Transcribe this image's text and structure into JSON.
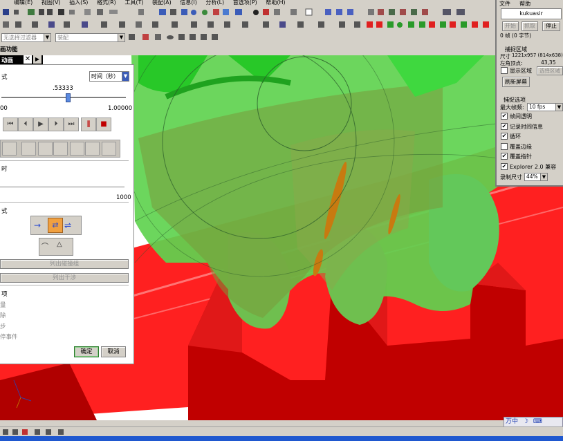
{
  "menubar": {
    "items": [
      "编辑(E)",
      "视图(V)",
      "插入(S)",
      "格式(R)",
      "工具(T)",
      "装配(A)",
      "信息(I)",
      "分析(L)",
      "首选项(P)",
      "帮助(H)"
    ]
  },
  "toolbar": {
    "combo1_text": "无选择过滤器",
    "combo2_text": "装配"
  },
  "tab_strip": {
    "title": "画功能",
    "tab_label": "动画"
  },
  "anim_panel": {
    "mode_label_1": "式",
    "time_select": "时间（秒）",
    "slider_value": ".53333",
    "slider_min": "00",
    "slider_max": "1.00000",
    "slider_fraction": 0.53,
    "section_time": "时",
    "steps_max": "1000",
    "mode_label_2": "式",
    "list_btn_1": "列出碰撞组",
    "list_btn_2": "列出干涉",
    "opt_header": "项",
    "opt_1": "量",
    "opt_2": "除",
    "opt_3": "步",
    "opt_4": "停事件",
    "ok": "确定",
    "cancel": "取消"
  },
  "recorder": {
    "menu_file": "文件",
    "menu_help": "帮助",
    "title_field": "kukuasir",
    "btn_start": "开始",
    "btn_capture": "抓取",
    "btn_stop": "停止",
    "frames_text": "0 帧 (0 字节)",
    "capture_area_header": "捕捉区域",
    "size_label": "尺寸",
    "size_value": "1221x957 (814x638)",
    "corner_label": "左角顶点:",
    "corner_value": "43,35",
    "show_area": "显示区域",
    "select_area": "选择区域",
    "refresh_screen": "刷新屏幕",
    "capture_opts_header": "捕捉选项",
    "max_fps_label": "最大帧频:",
    "max_fps_value": "10 fps",
    "options": [
      {
        "label": "帧间透明",
        "checked": true
      },
      {
        "label": "记录时间信息",
        "checked": true
      },
      {
        "label": "循环",
        "checked": true
      },
      {
        "label": "覆盖边缘",
        "checked": false
      },
      {
        "label": "覆盖指针",
        "checked": true
      },
      {
        "label": "Explorer 2.0 兼容",
        "checked": true
      }
    ],
    "record_size_label": "录制尺寸",
    "record_size_value": "44%"
  },
  "tray": {
    "ime_text": "万中"
  },
  "colors": {
    "rack_red": "#ff2020",
    "rack_dark": "#c00000",
    "gear_green": "#5fd24f",
    "gear_dark": "#3a8a2a",
    "olive": "#7a9a3a",
    "taskbar": "#1f58cf"
  }
}
